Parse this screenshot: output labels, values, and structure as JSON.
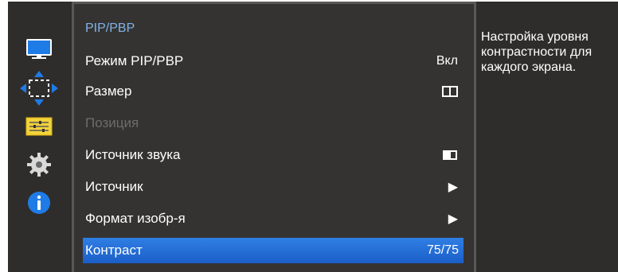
{
  "menu": {
    "title": "PIP/PBP",
    "items": [
      {
        "label": "Режим PIP/PBP",
        "value": "Вкл"
      },
      {
        "label": "Размер",
        "value": ""
      },
      {
        "label": "Позиция",
        "value": ""
      },
      {
        "label": "Источник звука",
        "value": ""
      },
      {
        "label": "Источник",
        "value": ""
      },
      {
        "label": "Формат изобр-я",
        "value": ""
      },
      {
        "label": "Контраст",
        "value": "75/75"
      }
    ]
  },
  "help": {
    "text": "Настройка уровня контрастности для каждого экрана."
  },
  "sidebar": {
    "icons": [
      "monitor-icon",
      "move-arrows-icon",
      "settings-sliders-icon",
      "gear-icon",
      "info-icon"
    ]
  },
  "colors": {
    "selected": "#2b78de",
    "title": "#7fb2e8",
    "panel": "#353331"
  }
}
